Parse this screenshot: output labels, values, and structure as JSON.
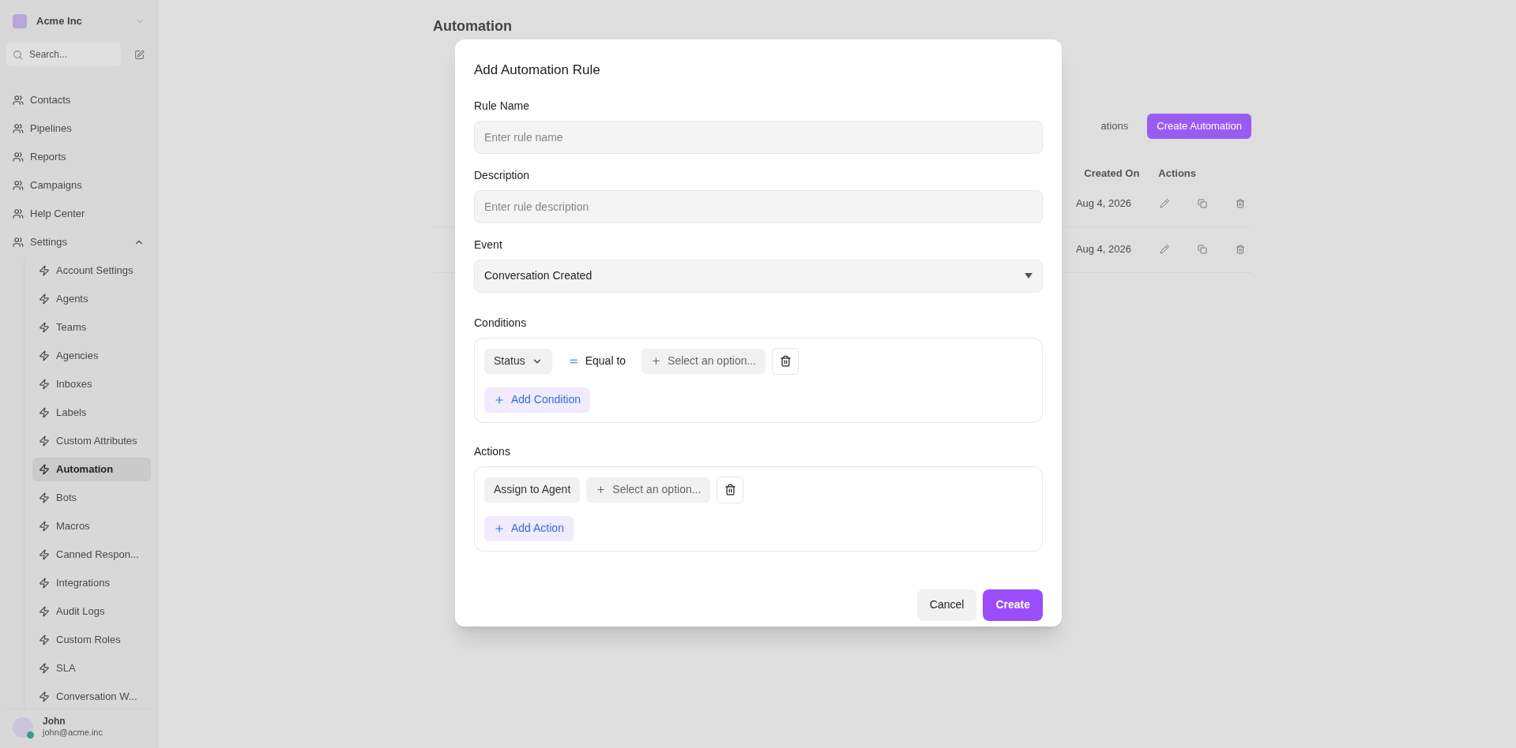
{
  "sidebar": {
    "workspace": "Acme Inc",
    "search_placeholder": "Search...",
    "items": [
      {
        "label": "Contacts",
        "selected": false
      },
      {
        "label": "Pipelines",
        "selected": false
      },
      {
        "label": "Reports",
        "selected": false
      },
      {
        "label": "Campaigns",
        "selected": false
      },
      {
        "label": "Help Center",
        "selected": false
      },
      {
        "label": "Settings",
        "selected": false,
        "expanded": true,
        "children": [
          {
            "label": "Account Settings",
            "selected": false
          },
          {
            "label": "Agents",
            "selected": false
          },
          {
            "label": "Teams",
            "selected": false
          },
          {
            "label": "Agencies",
            "selected": false
          },
          {
            "label": "Inboxes",
            "selected": false
          },
          {
            "label": "Labels",
            "selected": false
          },
          {
            "label": "Custom Attributes",
            "selected": false
          },
          {
            "label": "Automation",
            "selected": true
          },
          {
            "label": "Bots",
            "selected": false
          },
          {
            "label": "Macros",
            "selected": false
          },
          {
            "label": "Canned Respon...",
            "selected": false
          },
          {
            "label": "Integrations",
            "selected": false
          },
          {
            "label": "Audit Logs",
            "selected": false
          },
          {
            "label": "Custom Roles",
            "selected": false
          },
          {
            "label": "SLA",
            "selected": false
          },
          {
            "label": "Conversation W...",
            "selected": false
          }
        ]
      }
    ],
    "user": {
      "name": "John",
      "email": "john@acme.inc"
    }
  },
  "page": {
    "title": "Automation",
    "tab_fragment": "ations",
    "create_button": "Create Automation",
    "columns": [
      "Created On",
      "Actions"
    ],
    "rows": [
      {
        "created_on": "Aug 4, 2026"
      },
      {
        "created_on": "Aug 4, 2026"
      }
    ]
  },
  "dialog": {
    "title": "Add Automation Rule",
    "fields": [
      {
        "kind": "text",
        "label": "Rule Name",
        "placeholder": "Enter rule name"
      },
      {
        "kind": "text",
        "label": "Description",
        "placeholder": "Enter rule description"
      },
      {
        "kind": "select",
        "label": "Event",
        "value": "Conversation Created"
      }
    ],
    "conditions": {
      "label": "Conditions",
      "rows": [
        {
          "attribute": "Status",
          "operator": "Equal to",
          "value_placeholder": "Select an option..."
        }
      ],
      "add_button": "Add Condition"
    },
    "actions": {
      "label": "Actions",
      "rows": [
        {
          "action": "Assign to Agent",
          "value_placeholder": "Select an option..."
        }
      ],
      "add_button": "Add Action"
    },
    "buttons": {
      "cancel": "Cancel",
      "create": "Create"
    }
  }
}
